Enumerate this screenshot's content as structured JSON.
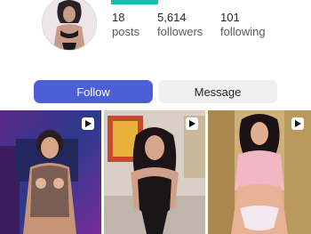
{
  "profile": {
    "avatar_icon": "profile-avatar",
    "stats": [
      {
        "value": "18",
        "label": "posts"
      },
      {
        "value": "5,614",
        "label": "followers"
      },
      {
        "value": "101",
        "label": "following"
      }
    ]
  },
  "actions": {
    "follow_label": "Follow",
    "message_label": "Message"
  },
  "grid": {
    "posts": [
      {
        "type": "reel",
        "icon": "video-icon"
      },
      {
        "type": "reel",
        "icon": "video-icon"
      },
      {
        "type": "reel",
        "icon": "video-icon"
      }
    ]
  },
  "colors": {
    "follow_button": "#4c5fd7",
    "message_button": "#efefef",
    "accent": "#18bfb0"
  }
}
